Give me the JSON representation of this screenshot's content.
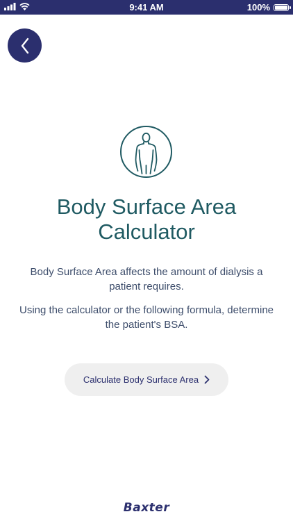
{
  "status_bar": {
    "time": "9:41 AM",
    "battery": "100%"
  },
  "header": {
    "back_icon": "chevron-left-icon"
  },
  "hero": {
    "icon": "human-body-icon"
  },
  "title": {
    "line1": "Body Surface Area",
    "line2": "Calculator"
  },
  "description": {
    "paragraph1": "Body Surface Area affects the amount of dialysis a patient requires.",
    "paragraph2": "Using the calculator or the following formula, determine the patient's BSA."
  },
  "cta": {
    "label": "Calculate Body Surface Area",
    "icon": "chevron-right-icon"
  },
  "footer": {
    "logo": "Baxter"
  },
  "colors": {
    "brand_navy": "#2b2f6e",
    "title_teal": "#1f5a62",
    "button_bg": "#efefef"
  }
}
